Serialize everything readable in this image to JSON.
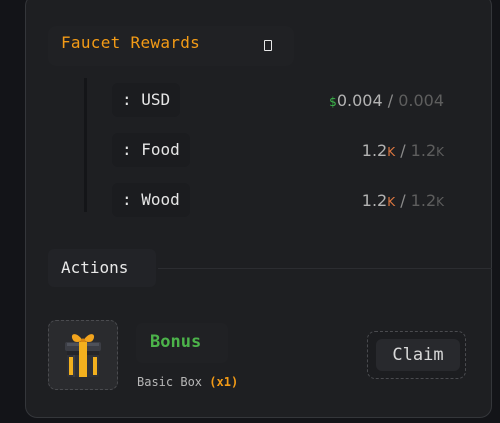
{
  "panel": {
    "title": "Faucet Rewards",
    "title_icon": "clipboard-icon"
  },
  "rewards": [
    {
      "label": ": USD",
      "currency_symbol": "$",
      "current": "0.004",
      "current_unit": "",
      "separator": " / ",
      "max": "0.004",
      "max_unit": ""
    },
    {
      "label": ": Food",
      "currency_symbol": "",
      "current": "1.2",
      "current_unit": "K",
      "separator": " / ",
      "max": "1.2",
      "max_unit": "K"
    },
    {
      "label": ": Wood",
      "currency_symbol": "",
      "current": "1.2",
      "current_unit": "K",
      "separator": " / ",
      "max": "1.2",
      "max_unit": "K"
    }
  ],
  "actions": {
    "heading": "Actions",
    "item": {
      "icon": "gift-box-icon",
      "name": "Bonus",
      "subtitle": "Basic Box",
      "quantity": "(x1)",
      "button": "Claim"
    }
  },
  "colors": {
    "accent_orange": "#f39b16",
    "green": "#4cb34a",
    "background": "#1e1f22"
  }
}
